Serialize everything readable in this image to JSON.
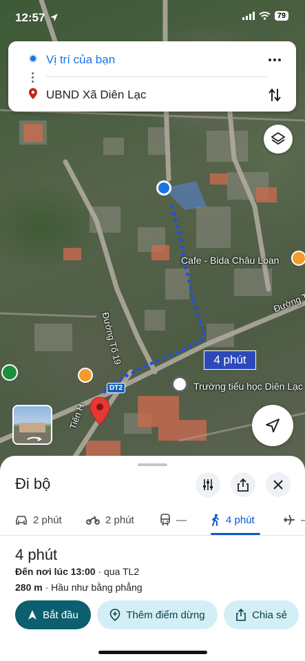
{
  "status": {
    "time": "12:57",
    "battery": "79"
  },
  "route": {
    "origin": "Vị trí của bạn",
    "destination": "UBND Xã Diên Lạc"
  },
  "map": {
    "labels": {
      "cafe": "Cafe - Bida Châu Loan",
      "school": "Trường tiểu học Diên Lạc",
      "road19": "Đường Tổ 19",
      "road_right": "Đường T",
      "tien": "Tiến H",
      "dt2": "DT2"
    },
    "duration_bubble": "4 phút"
  },
  "sheet": {
    "title": "Đi bộ",
    "modes": [
      {
        "icon": "car-icon",
        "label": "2 phút"
      },
      {
        "icon": "motorbike-icon",
        "label": "2 phút"
      },
      {
        "icon": "transit-icon",
        "label": "—"
      },
      {
        "icon": "walk-icon",
        "label": "4 phút"
      },
      {
        "icon": "flight-icon",
        "label": "–"
      }
    ],
    "summary": {
      "time": "4 phút",
      "arrive_prefix": "Đến nơi lúc 13:00",
      "via": " · qua TL2",
      "distance": "280 m",
      "terrain": " · Hầu như bằng phẳng"
    },
    "actions": {
      "start": "Bắt đầu",
      "add_stop": "Thêm điểm dừng",
      "share": "Chia sẻ"
    }
  },
  "colors": {
    "accent": "#0b57d0",
    "route": "#1a4ff0",
    "start_button": "#0b5f6f"
  }
}
